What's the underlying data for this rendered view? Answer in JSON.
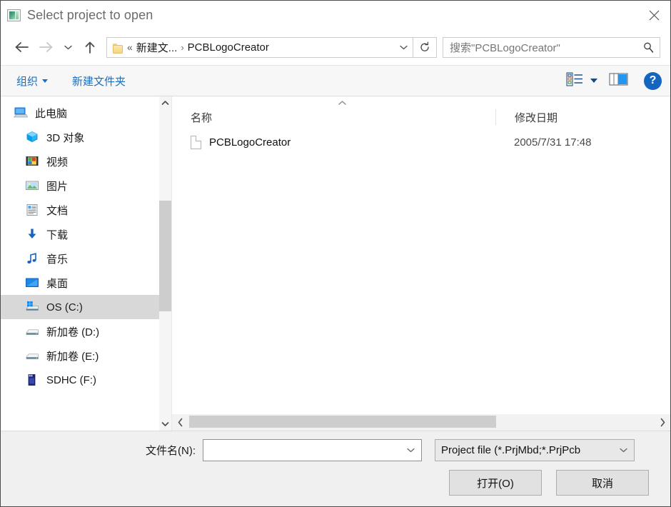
{
  "window": {
    "title": "Select project to open",
    "app_icon": "image-app-icon",
    "close_label": "✕"
  },
  "nav": {
    "back": "back-arrow",
    "forward": "forward-arrow",
    "recent": "recent-locations-chevron",
    "up": "up-arrow",
    "refresh": "refresh-arrow"
  },
  "address": {
    "folder_icon": "folder-icon",
    "separator_first": "«",
    "crumbs": [
      "新建文...",
      "PCBLogoCreator"
    ],
    "separator": "›",
    "dropdown": "chevron-down-icon"
  },
  "search": {
    "placeholder": "搜索\"PCBLogoCreator\"",
    "icon": "search-icon"
  },
  "commandbar": {
    "organize": "组织",
    "new_folder": "新建文件夹",
    "view_icon": "view-list-icon",
    "preview_icon": "preview-pane-icon",
    "help": "?"
  },
  "sidebar": {
    "items": [
      {
        "label": "此电脑",
        "icon": "this-pc-icon",
        "root": true,
        "selected": false
      },
      {
        "label": "3D 对象",
        "icon": "3d-objects-icon",
        "root": false,
        "selected": false
      },
      {
        "label": "视频",
        "icon": "videos-icon",
        "root": false,
        "selected": false
      },
      {
        "label": "图片",
        "icon": "pictures-icon",
        "root": false,
        "selected": false
      },
      {
        "label": "文档",
        "icon": "documents-icon",
        "root": false,
        "selected": false
      },
      {
        "label": "下载",
        "icon": "downloads-icon",
        "root": false,
        "selected": false
      },
      {
        "label": "音乐",
        "icon": "music-icon",
        "root": false,
        "selected": false
      },
      {
        "label": "桌面",
        "icon": "desktop-icon",
        "root": false,
        "selected": false
      },
      {
        "label": "OS (C:)",
        "icon": "windows-drive-icon",
        "root": false,
        "selected": true
      },
      {
        "label": "新加卷 (D:)",
        "icon": "drive-icon",
        "root": false,
        "selected": false
      },
      {
        "label": "新加卷 (E:)",
        "icon": "drive-icon",
        "root": false,
        "selected": false
      },
      {
        "label": "SDHC (F:)",
        "icon": "sdcard-icon",
        "root": false,
        "selected": false
      }
    ]
  },
  "filelist": {
    "columns": {
      "name": "名称",
      "date": "修改日期"
    },
    "sort_indicator": "sort-ascending-caret",
    "rows": [
      {
        "name": "PCBLogoCreator",
        "date": "2005/7/31 17:48",
        "icon": "document-icon"
      }
    ]
  },
  "footer": {
    "filename_label": "文件名(N):",
    "filename_value": "",
    "filetype_value": "Project file (*.PrjMbd;*.PrjPcb",
    "open_button": "打开(O)",
    "cancel_button": "取消"
  },
  "colors": {
    "accent_blue": "#1a6fc4",
    "selection_gray": "#d8d8d8",
    "scrollbar_thumb": "#cdcdcd"
  }
}
